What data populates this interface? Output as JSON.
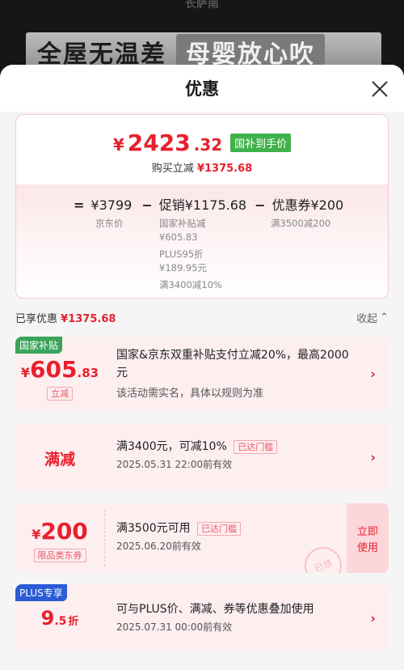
{
  "bg": {
    "brand": "长萨南",
    "banner_left": "全屋无温差",
    "banner_right": "母婴放心吹"
  },
  "sheet": {
    "title": "优惠",
    "close_icon": "close-icon"
  },
  "summary": {
    "price_currency": "¥",
    "price_int": "2423",
    "price_dec": ".32",
    "price_tag": "国补到手价",
    "buy_label": "购买立减",
    "buy_value": "¥1375.68",
    "formula": {
      "eq": "=",
      "base": "¥3799",
      "minus1": "−",
      "promo": "促销¥1175.68",
      "minus2": "−",
      "coupon": "优惠券¥200"
    },
    "base_label": "京东价",
    "promo_details": [
      "国家补贴减",
      "¥605.83",
      "PLUS95折",
      "¥189.95元",
      "满3400减10%"
    ],
    "coupon_detail": "满3500减200"
  },
  "applied": {
    "label": "已享优惠",
    "value": "¥1375.68",
    "collapse": "收起"
  },
  "coupons": [
    {
      "badge": "国家补贴",
      "currency": "¥",
      "amount_int": "605",
      "amount_dec": ".83",
      "kind": "立减",
      "desc": "国家&京东双重补贴支付立减20%，最高2000元",
      "sub": "该活动需实名，具体以规则为准"
    },
    {
      "title": "满减",
      "desc": "满3400元，可减10%",
      "tag": "已达门槛",
      "sub": "2025.05.31 22:00前有效"
    },
    {
      "currency": "¥",
      "amount": "200",
      "kind": "限品类东券",
      "desc": "满3500元可用",
      "tag": "已达门槛",
      "sub": "2025.06.20前有效",
      "action": "立即使用",
      "stamp": "已领"
    },
    {
      "badge": "PLUS专享",
      "amount_int": "9",
      "amount_dec": ".5",
      "unit": "折",
      "desc": "可与PLUS价、满减、券等优惠叠加使用",
      "sub": "2025.07.31 00:00前有效"
    }
  ],
  "colors": {
    "accent": "#e8202e",
    "green": "#3fb24b",
    "plus_blue": "#2b5cd6"
  }
}
